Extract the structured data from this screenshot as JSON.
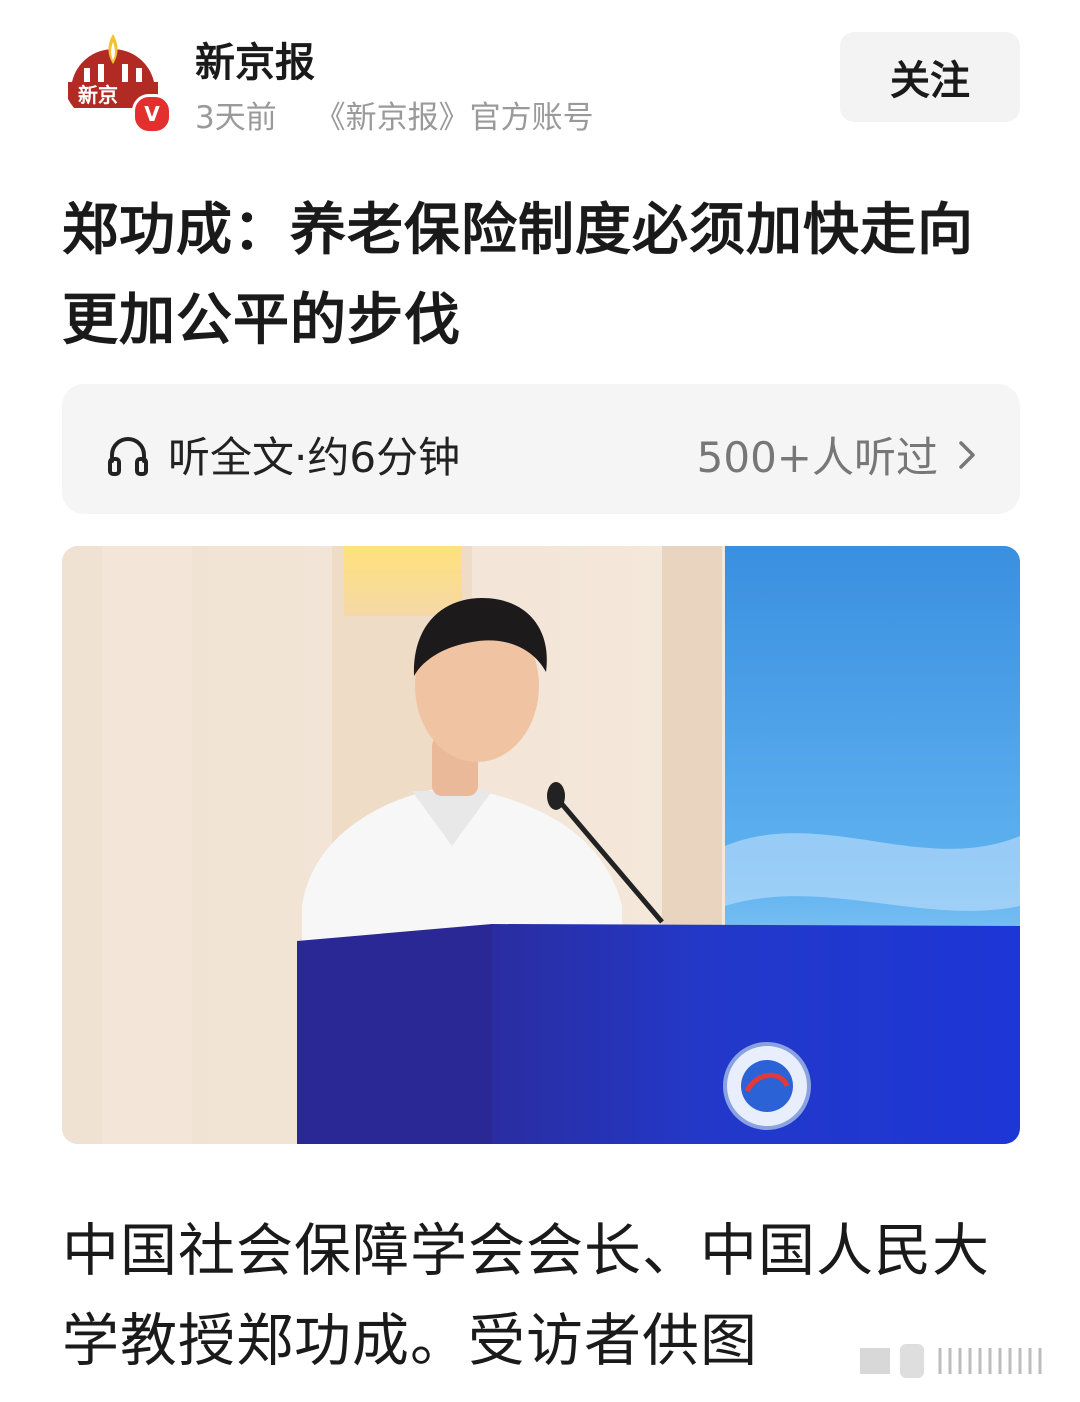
{
  "header": {
    "source_name": "新京报",
    "time_ago": "3天前",
    "account_desc": "《新京报》官方账号",
    "follow_label": "关注",
    "verified_mark": "V",
    "avatar_logo_text": "新京"
  },
  "article": {
    "title": "郑功成：养老保险制度必须加快走向更加公平的步伐",
    "listen": {
      "label": "听全文·约6分钟",
      "count": "500+人听过"
    },
    "photo_caption": "中国社会保障学会会长、中国人民大学教授郑功成。受访者供图"
  },
  "colors": {
    "brand_red": "#e3302f",
    "podium_blue": "#1f2fb0",
    "muted_text": "#9a9a9a"
  },
  "icons": [
    "headphones-icon",
    "chevron-right-icon",
    "verified-icon",
    "speaker-photo"
  ]
}
